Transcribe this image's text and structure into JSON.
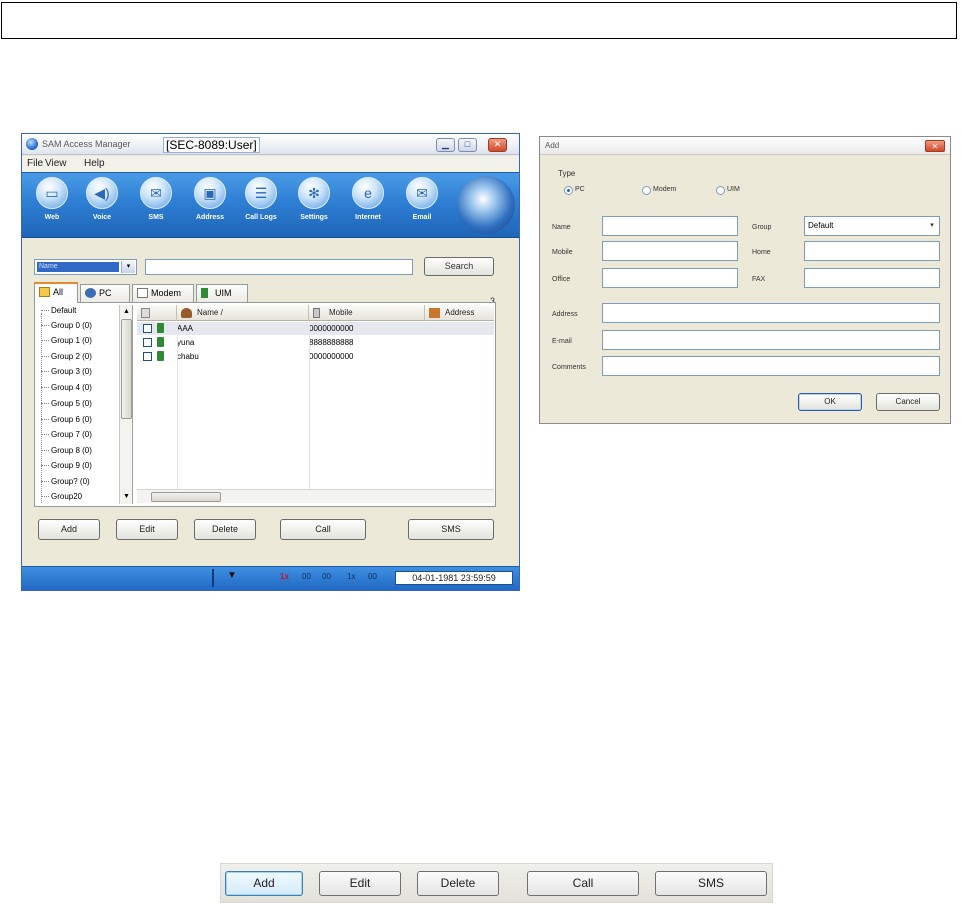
{
  "main_window": {
    "title": "SAM Access Manager",
    "title_overlay": "[SEC-8089:User]",
    "controls": {
      "minimize": "▁",
      "maximize": "□",
      "close": "✕"
    },
    "menu": [
      "File",
      "View",
      "Help"
    ],
    "toolbar": [
      {
        "label": "Web",
        "icon": "web-icon",
        "glyph": "▭"
      },
      {
        "label": "Voice",
        "icon": "speaker-icon",
        "glyph": "◀)"
      },
      {
        "label": "SMS",
        "icon": "envelope-icon",
        "glyph": "✉"
      },
      {
        "label": "Address",
        "icon": "address-book-icon",
        "glyph": "▣"
      },
      {
        "label": "Call Logs",
        "icon": "list-icon",
        "glyph": "☰"
      },
      {
        "label": "Settings",
        "icon": "gear-icon",
        "glyph": "✻"
      },
      {
        "label": "Internet",
        "icon": "internet-explorer-icon",
        "glyph": "e"
      },
      {
        "label": "Email",
        "icon": "mail-icon",
        "glyph": "✉"
      }
    ],
    "search": {
      "combo_value": "Name",
      "combo_arrow": "▾",
      "query": "",
      "button": "Search"
    },
    "tabs": [
      "All",
      "PC",
      "Modem",
      "UIM"
    ],
    "tab_count": "3",
    "tree": {
      "items": [
        "Default",
        "Group 0 (0)",
        "Group 1 (0)",
        "Group 2 (0)",
        "Group 3 (0)",
        "Group 4 (0)",
        "Group 5 (0)",
        "Group 6 (0)",
        "Group 7 (0)",
        "Group 8 (0)",
        "Group 9 (0)",
        "Group? (0)",
        "Group20"
      ],
      "scroll_up": "▲",
      "scroll_down": "▼"
    },
    "list": {
      "columns": [
        "",
        "Name  /",
        "Mobile",
        "Address"
      ],
      "rows": [
        {
          "name": "AAA",
          "mobile": "0000000000"
        },
        {
          "name": "yuna",
          "mobile": "8888888888"
        },
        {
          "name": "chabu",
          "mobile": "0000000000"
        }
      ]
    },
    "buttons": [
      "Add",
      "Edit",
      "Delete",
      "Call",
      "SMS"
    ],
    "status": {
      "signal": "▼",
      "items": [
        "1x",
        "00",
        "00",
        "1x",
        "00"
      ],
      "clock": "04-01-1981 23:59:59"
    }
  },
  "add_dialog": {
    "title": "Add",
    "close": "✕",
    "type_label": "Type",
    "type_options": [
      "PC",
      "Modem",
      "UIM"
    ],
    "fields": {
      "name_label": "Name",
      "group_label": "Group",
      "group_value": "Default",
      "group_arrow": "▾",
      "mobile_label": "Mobile",
      "home_label": "Home",
      "office_label": "Office",
      "fax_label": "FAX",
      "address_label": "Address",
      "email_label": "E-mail",
      "comments_label": "Comments"
    },
    "buttons": {
      "ok": "OK",
      "cancel": "Cancel"
    }
  },
  "button_strip": [
    "Add",
    "Edit",
    "Delete",
    "Call",
    "SMS"
  ],
  "colors": {
    "toolbar_blue": "#2e7fd4",
    "arrow_red": "#ee1c14",
    "selection_blue": "#3169c6"
  }
}
